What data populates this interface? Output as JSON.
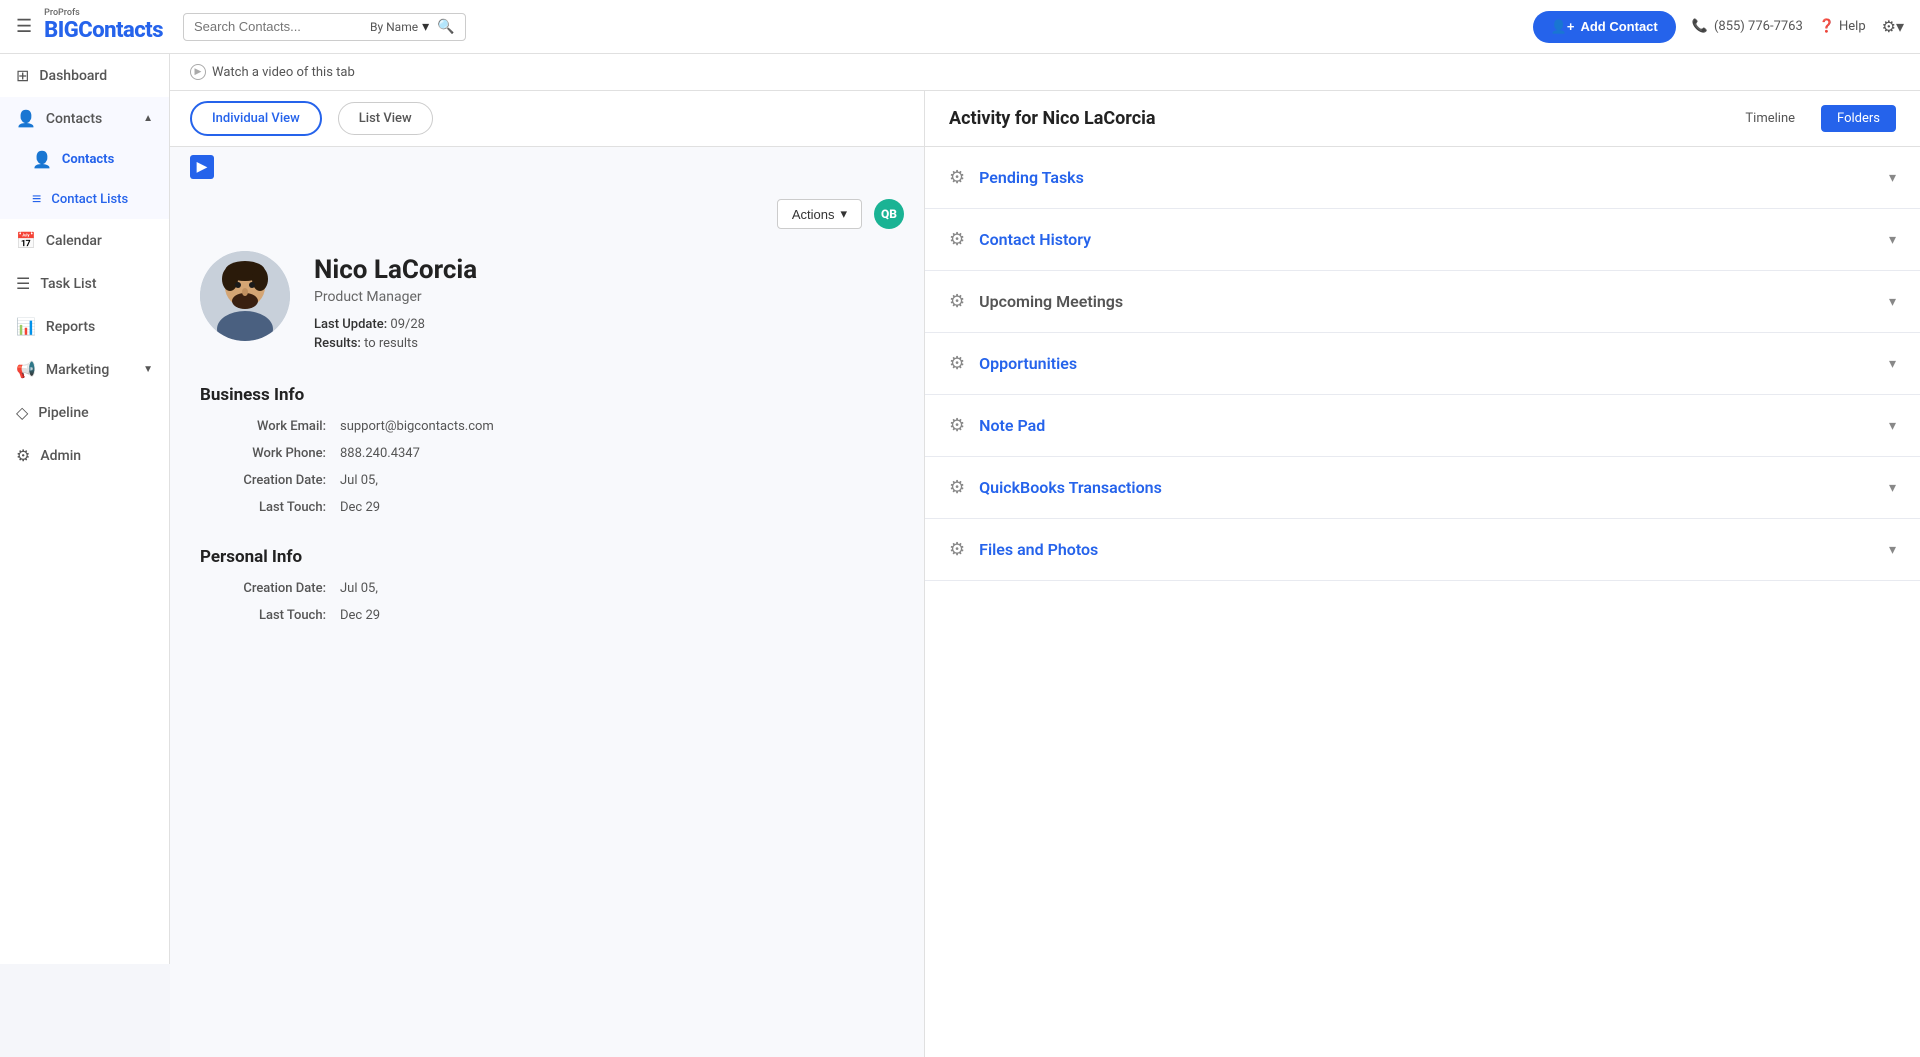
{
  "topnav": {
    "menu_icon": "☰",
    "logo_proprofs": "ProProfs",
    "logo_brand": "BIGContacts",
    "search_placeholder": "Search Contacts...",
    "search_by": "By Name",
    "add_contact_label": "Add Contact",
    "phone": "(855) 776-7763",
    "help": "Help",
    "settings_icon": "⚙"
  },
  "sidebar": {
    "items": [
      {
        "id": "dashboard",
        "label": "Dashboard",
        "icon": "⊞"
      },
      {
        "id": "contacts",
        "label": "Contacts",
        "icon": "👤",
        "expanded": true
      },
      {
        "id": "contacts-sub",
        "label": "Contacts",
        "icon": "👤",
        "sub": true
      },
      {
        "id": "contact-lists",
        "label": "Contact Lists",
        "icon": "≡",
        "sub": true
      },
      {
        "id": "calendar",
        "label": "Calendar",
        "icon": "📅"
      },
      {
        "id": "task-list",
        "label": "Task List",
        "icon": "☰"
      },
      {
        "id": "reports",
        "label": "Reports",
        "icon": "📊"
      },
      {
        "id": "marketing",
        "label": "Marketing",
        "icon": "📢",
        "has_chevron": true
      },
      {
        "id": "pipeline",
        "label": "Pipeline",
        "icon": "◇"
      },
      {
        "id": "admin",
        "label": "Admin",
        "icon": "⚙"
      }
    ]
  },
  "toolbar": {
    "watch_video_label": "Watch a video of this tab"
  },
  "view_tabs": {
    "individual": "Individual View",
    "list": "List View"
  },
  "contact": {
    "name": "Nico LaCorcia",
    "title": "Product Manager",
    "last_update_label": "Last Update:",
    "last_update_value": "09/28",
    "results_label": "Results:",
    "results_value": "to results"
  },
  "actions_btn": "Actions",
  "business_info": {
    "section_label": "Business Info",
    "work_email_label": "Work Email:",
    "work_email_value": "support@bigcontacts.com",
    "work_phone_label": "Work Phone:",
    "work_phone_value": "888.240.4347",
    "creation_date_label": "Creation Date:",
    "creation_date_value": "Jul 05,",
    "last_touch_label": "Last Touch:",
    "last_touch_value": "Dec 29"
  },
  "personal_info": {
    "section_label": "Personal Info",
    "creation_date_label": "Creation Date:",
    "creation_date_value": "Jul 05,",
    "last_touch_label": "Last Touch:",
    "last_touch_value": "Dec 29"
  },
  "activity": {
    "title": "Activity for Nico LaCorcia",
    "tabs": [
      {
        "id": "timeline",
        "label": "Timeline"
      },
      {
        "id": "folders",
        "label": "Folders",
        "active": true
      }
    ],
    "sections": [
      {
        "id": "pending-tasks",
        "label": "Pending Tasks",
        "active": true
      },
      {
        "id": "contact-history",
        "label": "Contact History",
        "active": true
      },
      {
        "id": "upcoming-meetings",
        "label": "Upcoming Meetings",
        "active": false
      },
      {
        "id": "opportunities",
        "label": "Opportunities",
        "active": true
      },
      {
        "id": "note-pad",
        "label": "Note Pad",
        "active": true
      },
      {
        "id": "quickbooks-transactions",
        "label": "QuickBooks Transactions",
        "active": true
      },
      {
        "id": "files-and-photos",
        "label": "Files and Photos",
        "active": true
      }
    ]
  }
}
